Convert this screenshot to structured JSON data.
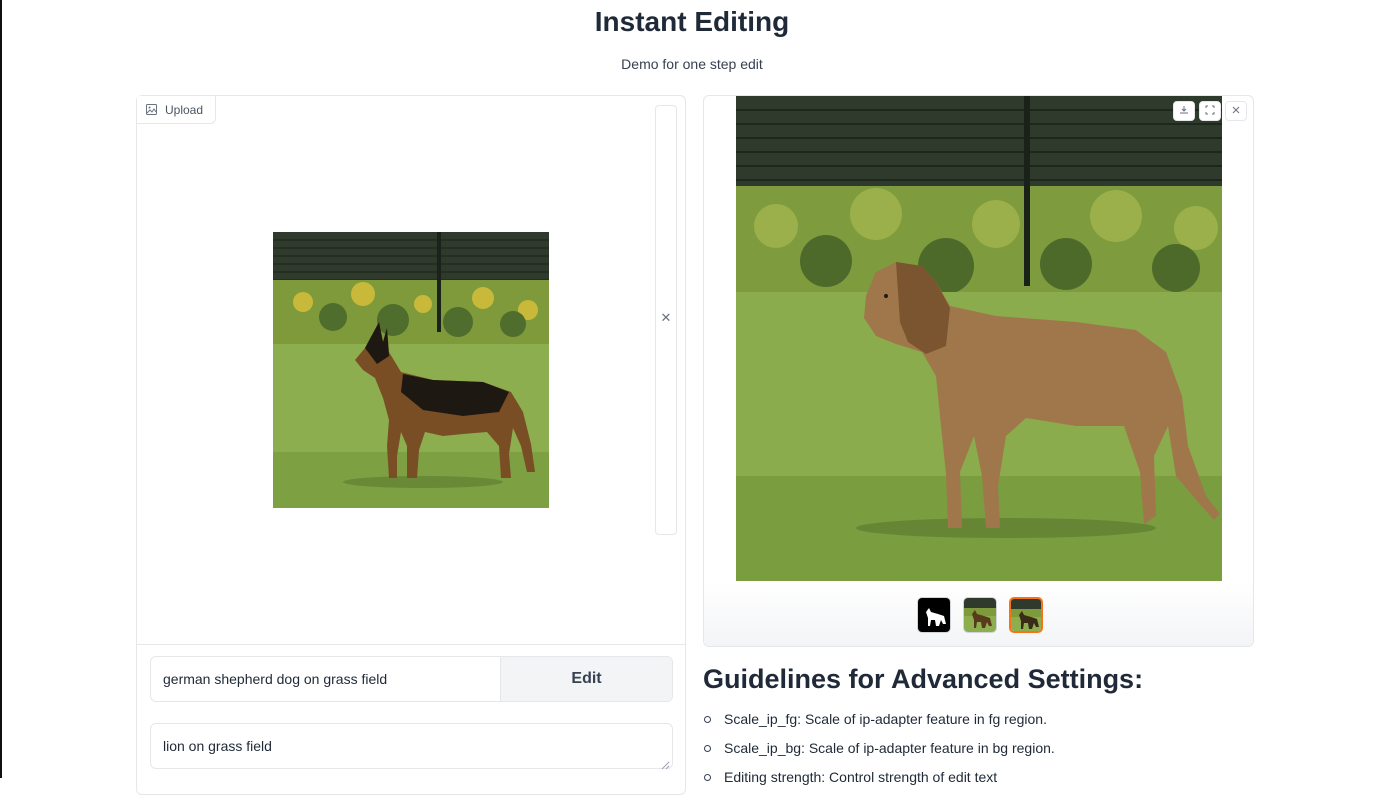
{
  "header": {
    "title": "Instant Editing",
    "subtitle": "Demo for one step edit"
  },
  "input_panel": {
    "upload_tab_label": "Upload",
    "clear_icon": "close-icon",
    "source_prompt": "german shepherd dog on grass field",
    "edit_button_label": "Edit",
    "target_prompt": "lion on grass field"
  },
  "output_panel": {
    "toolbar_icons": [
      "download-icon",
      "fullscreen-icon",
      "close-icon"
    ],
    "thumbnails": [
      "mask",
      "source",
      "result"
    ],
    "selected_thumbnail": "result",
    "selected_color": "#f97316"
  },
  "guidelines": {
    "title": "Guidelines for Advanced Settings:",
    "items": [
      "Scale_ip_fg: Scale of ip-adapter feature in fg region.",
      "Scale_ip_bg: Scale of ip-adapter feature in bg region.",
      "Editing strength: Control strength of edit text"
    ]
  }
}
